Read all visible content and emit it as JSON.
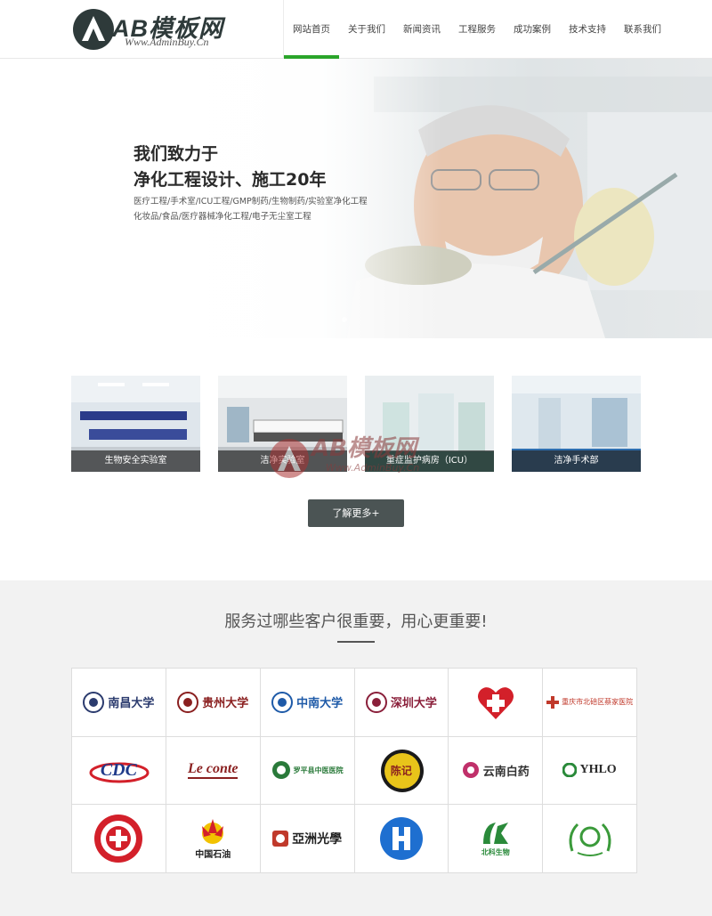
{
  "header": {
    "logo_text": "AB模板网",
    "logo_sub": "Www.AdminBuy.Cn",
    "nav": [
      {
        "label": "网站首页",
        "active": true
      },
      {
        "label": "关于我们",
        "active": false
      },
      {
        "label": "新闻资讯",
        "active": false
      },
      {
        "label": "工程服务",
        "active": false
      },
      {
        "label": "成功案例",
        "active": false
      },
      {
        "label": "技术支持",
        "active": false
      },
      {
        "label": "联系我们",
        "active": false
      }
    ]
  },
  "banner": {
    "title_line1": "我们致力于",
    "title_line2": "净化工程设计、施工20年",
    "sub_line1": "医疗工程/手术室/ICU工程/GMP制药/生物制药/实验室净化工程",
    "sub_line2": "化妆品/食品/医疗器械净化工程/电子无尘室工程"
  },
  "cases": [
    {
      "caption": "生物安全实验室"
    },
    {
      "caption": "洁净实验室"
    },
    {
      "caption": "重症监护病房（ICU）"
    },
    {
      "caption": "洁净手术部"
    }
  ],
  "more_button": "了解更多+",
  "watermark": {
    "text": "AB模板网",
    "sub": "Www.AdminBuy.Cn"
  },
  "clients": {
    "title": "服务过哪些客户很重要，用心更重要!",
    "logos": [
      {
        "name": "南昌大学",
        "color": "#2b3b6e"
      },
      {
        "name": "贵州大学",
        "color": "#8a1f1f"
      },
      {
        "name": "中南大学",
        "color": "#1e5aa8"
      },
      {
        "name": "深圳大学",
        "color": "#8a1f3a"
      },
      {
        "name": "",
        "color": "#d3202a"
      },
      {
        "name": "重庆市北碚区蔡家医院",
        "color": "#c0392b"
      },
      {
        "name": "CDC",
        "color": "#1f3a8a"
      },
      {
        "name": "Le conte",
        "color": "#8a1f1f"
      },
      {
        "name": "罗平县中医医院",
        "color": "#2a7a3a"
      },
      {
        "name": "陈记",
        "color": "#d4a017"
      },
      {
        "name": "云南白药",
        "color": "#333333"
      },
      {
        "name": "YHLO",
        "color": "#2a2a2a"
      },
      {
        "name": "",
        "color": "#d3202a"
      },
      {
        "name": "中国石油",
        "color": "#d3202a"
      },
      {
        "name": "亞洲光學",
        "color": "#c0392b"
      },
      {
        "name": "",
        "color": "#1e6fd0"
      },
      {
        "name": "北科生物",
        "color": "#2a8a3a"
      },
      {
        "name": "",
        "color": "#3a9a3a"
      }
    ]
  }
}
